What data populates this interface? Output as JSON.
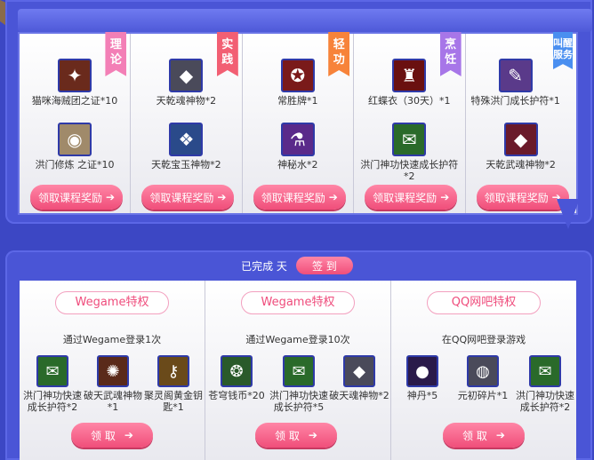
{
  "courses": [
    {
      "ribbon": "理论",
      "ribbon_color": "#f37fb6",
      "items": [
        {
          "icon": "compass-icon",
          "glyph": "✦",
          "bg": "#6a2a1c",
          "label": "猫咪海贼团之证*10"
        },
        {
          "icon": "medal-icon",
          "glyph": "◉",
          "bg": "#a08a6a",
          "label": "洪门修炼 之证*10"
        }
      ],
      "button": "领取课程奖励"
    },
    {
      "ribbon": "实践",
      "ribbon_color": "#f25f73",
      "items": [
        {
          "icon": "silver-ore-icon",
          "glyph": "◆",
          "bg": "#4a4a5a",
          "label": "天乾魂神物*2"
        },
        {
          "icon": "blue-gem-icon",
          "glyph": "❖",
          "bg": "#2a4a8a",
          "label": "天乾宝玉神物*2"
        }
      ],
      "button": "领取课程奖励"
    },
    {
      "ribbon": "轻功",
      "ribbon_color": "#f7833a",
      "items": [
        {
          "icon": "red-token-icon",
          "glyph": "✪",
          "bg": "#7a1a1a",
          "label": "常胜牌*1"
        },
        {
          "icon": "potion-icon",
          "glyph": "⚗",
          "bg": "#5a2a8a",
          "label": "神秘水*2"
        }
      ],
      "button": "领取课程奖励"
    },
    {
      "ribbon": "烹饪",
      "ribbon_color": "#a776e8",
      "items": [
        {
          "icon": "red-robe-icon",
          "glyph": "♜",
          "bg": "#6a1010",
          "label": "红蝶衣（30天）*1"
        },
        {
          "icon": "talisman-icon",
          "glyph": "✉",
          "bg": "#2a6a2a",
          "label": "洪门神功快速成长护符*2"
        }
      ],
      "button": "领取课程奖励"
    },
    {
      "ribbon": "叫醒服务",
      "ribbon_color": "#4a8ff0",
      "items": [
        {
          "icon": "scroll-icon",
          "glyph": "✎",
          "bg": "#5a3a8a",
          "label": "特殊洪门成长护符*1"
        },
        {
          "icon": "red-ore-icon",
          "glyph": "◆",
          "bg": "#6a1a2a",
          "label": "天乾武魂神物*2"
        }
      ],
      "button": "领取课程奖励"
    }
  ],
  "signin": {
    "status": "已完成 天",
    "button": "签 到"
  },
  "privileges": [
    {
      "title": "Wegame特权",
      "desc": "通过Wegame登录1次",
      "items": [
        {
          "icon": "talisman-icon",
          "glyph": "✉",
          "bg": "#2a6a2a",
          "label": "洪门神功快速成长护符*2"
        },
        {
          "icon": "fire-orb-icon",
          "glyph": "✺",
          "bg": "#5a2a1a",
          "label": "破天武魂神物*1"
        },
        {
          "icon": "golden-key-icon",
          "glyph": "⚷",
          "bg": "#6a4a1a",
          "label": "聚灵阁黄金钥匙*1"
        }
      ],
      "button": "领 取"
    },
    {
      "title": "Wegame特权",
      "desc": "通过Wegame登录10次",
      "items": [
        {
          "icon": "green-coin-icon",
          "glyph": "❂",
          "bg": "#2a5a2a",
          "label": "苍穹钱币*20"
        },
        {
          "icon": "talisman-icon",
          "glyph": "✉",
          "bg": "#2a6a2a",
          "label": "洪门神功快速成长护符*5"
        },
        {
          "icon": "silver-ore-icon",
          "glyph": "◆",
          "bg": "#4a4a5a",
          "label": "破天魂神物*2"
        }
      ],
      "button": "领 取"
    },
    {
      "title": "QQ网吧特权",
      "desc": "在QQ网吧登录游戏",
      "items": [
        {
          "icon": "pearl-icon",
          "glyph": "●",
          "bg": "#2a1a4a",
          "label": "神丹*5"
        },
        {
          "icon": "silver-shard-icon",
          "glyph": "◍",
          "bg": "#4a4a5a",
          "label": "元初碎片*1"
        },
        {
          "icon": "talisman-icon",
          "glyph": "✉",
          "bg": "#2a6a2a",
          "label": "洪门神功快速成长护符*2"
        }
      ],
      "button": "领 取"
    }
  ],
  "arrow": "➔"
}
